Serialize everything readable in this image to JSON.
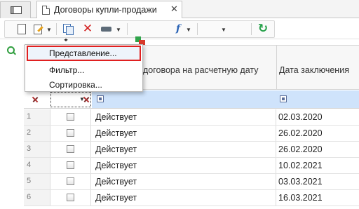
{
  "tabs": {
    "icon_tab_icon": "window-icon",
    "active_tab": {
      "label": "Договоры купли-продажи",
      "icon": "document-icon",
      "close": "✕"
    }
  },
  "toolbar": {
    "buttons": [
      "new-document-icon",
      "edit-icon",
      "copy-icon",
      "delete-icon",
      "print-icon",
      "export-icon",
      "clipboard-icon",
      "formula-icon",
      "list-icon",
      "filter-icon",
      "refresh-icon"
    ],
    "formula_glyph": "f",
    "delete_glyph": "✕",
    "refresh_glyph": "↻"
  },
  "grid": {
    "headers": {
      "status": "Статус договора на расчетную дату",
      "status_visible": "договора на расчетную дату",
      "date": "Дата заключения"
    },
    "rows": [
      {
        "num": "1",
        "status": "Действует",
        "date": "02.03.2020"
      },
      {
        "num": "2",
        "status": "Действует",
        "date": "26.02.2020"
      },
      {
        "num": "3",
        "status": "Действует",
        "date": "26.02.2020"
      },
      {
        "num": "4",
        "status": "Действует",
        "date": "10.02.2021"
      },
      {
        "num": "5",
        "status": "Действует",
        "date": "03.03.2021"
      },
      {
        "num": "6",
        "status": "Действует",
        "date": "16.03.2021"
      }
    ]
  },
  "context_menu": {
    "items": [
      "Представление...",
      "Фильтр...",
      "Сортировка..."
    ],
    "focused_index": 0
  },
  "colors": {
    "filter_highlight": "#cfe3fb",
    "focus_outline": "#e02020",
    "search_green": "#2f9e3e"
  }
}
